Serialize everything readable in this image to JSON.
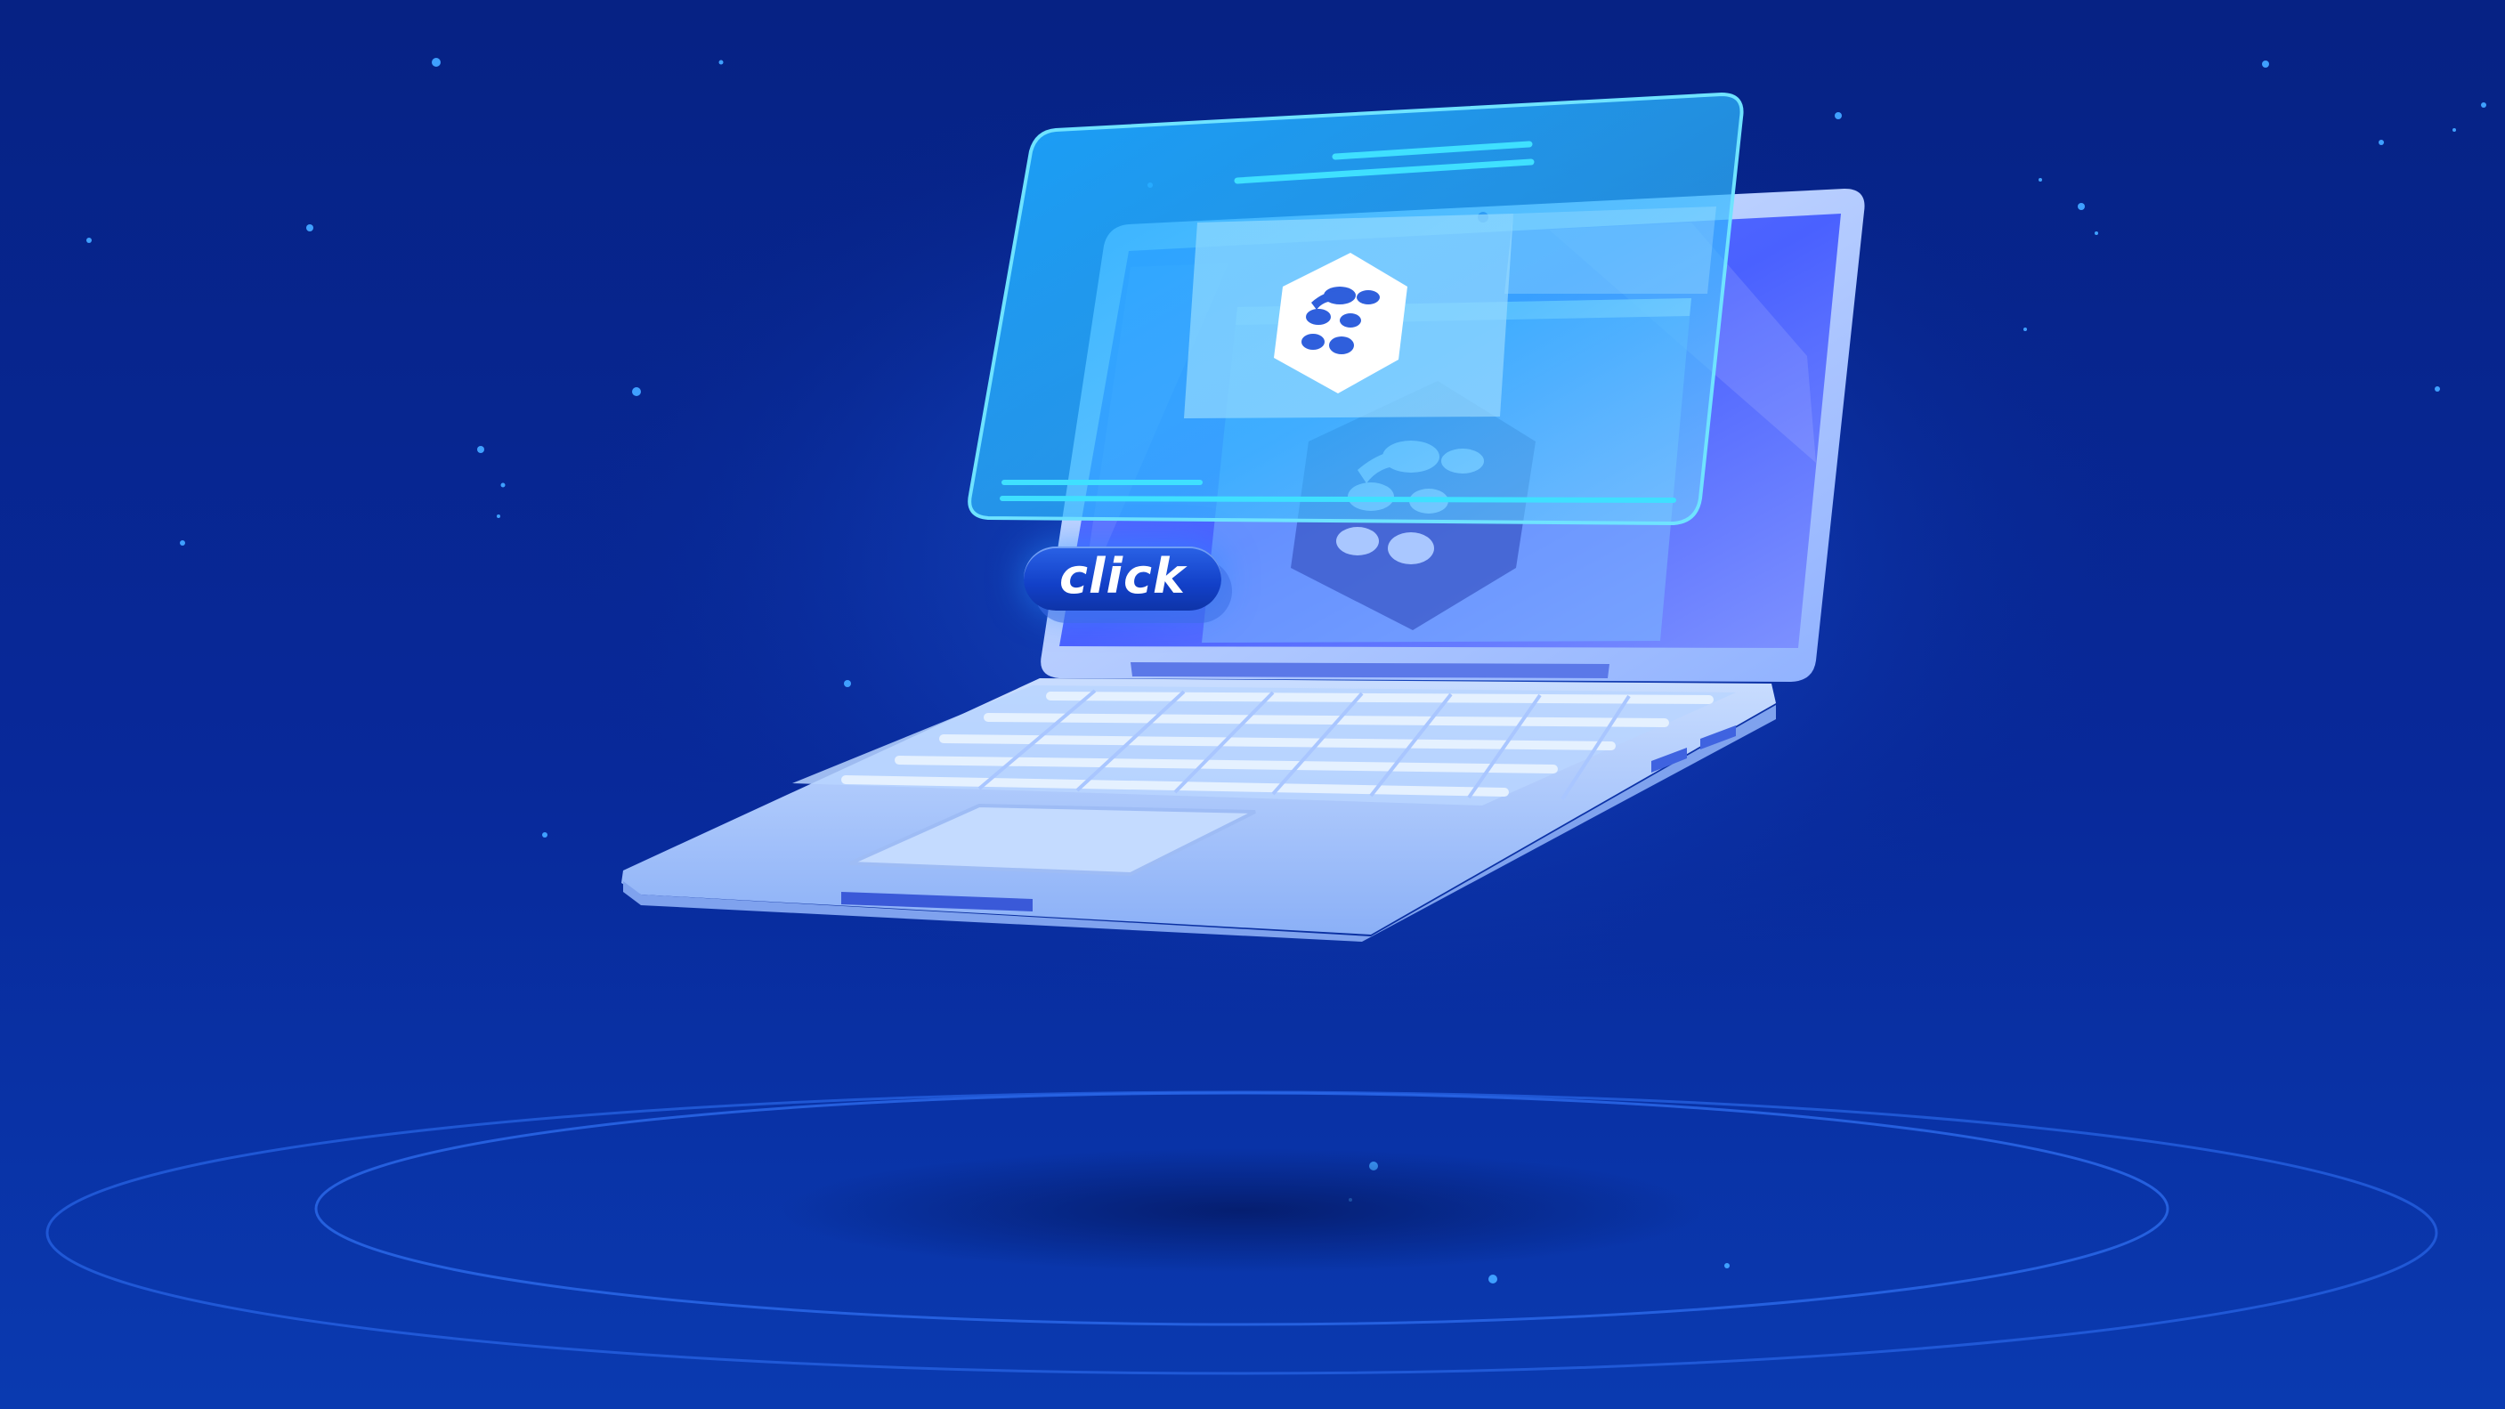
{
  "scene": {
    "badge_label": "click",
    "icons": [
      "laptop-icon",
      "floating-window-icon",
      "hexagon-logo-icon",
      "orbit-rings"
    ],
    "colors": {
      "background_top": "#062284",
      "background_bottom": "#0a3aaf",
      "screen": "#4e66ff",
      "glass_panel": "#18a8ff",
      "accent_line": "#3fe0ff",
      "laptop_body": "#a9c7ff",
      "badge": "#1a48d6"
    }
  }
}
